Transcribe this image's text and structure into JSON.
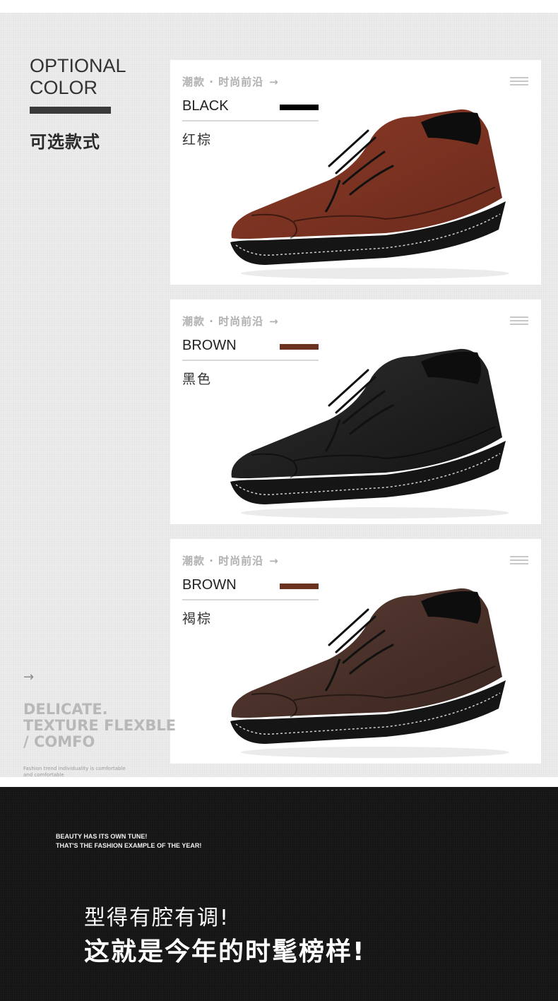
{
  "header": {
    "title_en": [
      "OPTIONAL",
      "COLOR"
    ],
    "title_cn": "可选款式"
  },
  "cards": [
    {
      "tag": "潮款 · 时尚前沿",
      "tag_arrow": "→",
      "color_en": "BLACK",
      "swatch_color": "#000000",
      "color_cn": "红棕",
      "shoe_color": "#6b2a1c",
      "shoe_color_light": "#8c3b27",
      "icon": "menu-icon"
    },
    {
      "tag": "潮款 · 时尚前沿",
      "tag_arrow": "→",
      "color_en": "BROWN",
      "swatch_color": "#6b3222",
      "color_cn": "黑色",
      "shoe_color": "#141414",
      "shoe_color_light": "#2e2e2e",
      "icon": "menu-icon"
    },
    {
      "tag": "潮款 · 时尚前沿",
      "tag_arrow": "→",
      "color_en": "BROWN",
      "swatch_color": "#6b3222",
      "color_cn": "褐棕",
      "shoe_color": "#3a2620",
      "shoe_color_light": "#5a3c33",
      "icon": "menu-icon"
    }
  ],
  "side": {
    "arrow": "→",
    "lines": [
      "DELICATE.",
      "TEXTURE FLEXBLE",
      "/ COMFO"
    ],
    "small": [
      "Fashion trend individuality is comfortable",
      "and comfortable"
    ]
  },
  "bottom": {
    "en": [
      "BEAUTY HAS ITS OWN TUNE!",
      "THAT'S THE FASHION EXAMPLE OF THE YEAR!"
    ],
    "cn1": "型得有腔有调!",
    "cn2": "这就是今年的时髦榜样!"
  }
}
